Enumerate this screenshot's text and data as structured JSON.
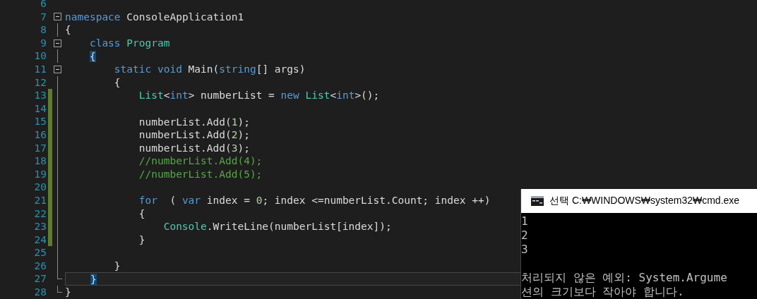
{
  "editor": {
    "lines": [
      {
        "number": "6"
      },
      {
        "number": "7",
        "collapsible": true,
        "tokens": [
          {
            "kind": "kw",
            "text": "namespace"
          },
          {
            "kind": "plain",
            "text": " ConsoleApplication1"
          }
        ]
      },
      {
        "number": "8",
        "in_block": true,
        "tokens": [
          {
            "kind": "plain",
            "text": "{"
          }
        ]
      },
      {
        "number": "9",
        "collapsible": true,
        "tokens": [
          {
            "kind": "kw",
            "text": "    class"
          },
          {
            "kind": "type",
            "text": " Program"
          }
        ]
      },
      {
        "number": "10",
        "in_block": true,
        "tokens": [
          {
            "kind": "brace",
            "text": "    {"
          }
        ]
      },
      {
        "number": "11",
        "collapsible": true,
        "tokens": [
          {
            "kind": "kw",
            "text": "        static void"
          },
          {
            "kind": "plain",
            "text": " Main("
          },
          {
            "kind": "kw",
            "text": "string"
          },
          {
            "kind": "plain",
            "text": "[] args)"
          }
        ]
      },
      {
        "number": "12",
        "in_block": true,
        "tokens": [
          {
            "kind": "plain",
            "text": "        {"
          }
        ]
      },
      {
        "number": "13",
        "in_block": true,
        "changed": true,
        "tokens": [
          {
            "kind": "type",
            "text": "            List"
          },
          {
            "kind": "plain",
            "text": "<"
          },
          {
            "kind": "kw",
            "text": "int"
          },
          {
            "kind": "plain",
            "text": "> numberList = "
          },
          {
            "kind": "kw",
            "text": "new"
          },
          {
            "kind": "type",
            "text": " List"
          },
          {
            "kind": "plain",
            "text": "<"
          },
          {
            "kind": "kw",
            "text": "int"
          },
          {
            "kind": "plain",
            "text": ">();"
          }
        ]
      },
      {
        "number": "14",
        "in_block": true,
        "changed": true
      },
      {
        "number": "15",
        "in_block": true,
        "changed": true,
        "tokens": [
          {
            "kind": "plain",
            "text": "            numberList.Add("
          },
          {
            "kind": "num",
            "text": "1"
          },
          {
            "kind": "plain",
            "text": ");"
          }
        ]
      },
      {
        "number": "16",
        "in_block": true,
        "changed": true,
        "tokens": [
          {
            "kind": "plain",
            "text": "            numberList.Add("
          },
          {
            "kind": "num",
            "text": "2"
          },
          {
            "kind": "plain",
            "text": ");"
          }
        ]
      },
      {
        "number": "17",
        "in_block": true,
        "changed": true,
        "tokens": [
          {
            "kind": "plain",
            "text": "            numberList.Add("
          },
          {
            "kind": "num",
            "text": "3"
          },
          {
            "kind": "plain",
            "text": ");"
          }
        ]
      },
      {
        "number": "18",
        "in_block": true,
        "changed": true,
        "tokens": [
          {
            "kind": "comment",
            "text": "            //numberList.Add(4);"
          }
        ]
      },
      {
        "number": "19",
        "in_block": true,
        "changed": true,
        "tokens": [
          {
            "kind": "comment",
            "text": "            //numberList.Add(5);"
          }
        ]
      },
      {
        "number": "20",
        "in_block": true,
        "changed": true
      },
      {
        "number": "21",
        "in_block": true,
        "changed": true,
        "tokens": [
          {
            "kind": "kw",
            "text": "            for"
          },
          {
            "kind": "plain",
            "text": "  ( "
          },
          {
            "kind": "kw",
            "text": "var"
          },
          {
            "kind": "plain",
            "text": " index = "
          },
          {
            "kind": "num",
            "text": "0"
          },
          {
            "kind": "plain",
            "text": "; index <=numberList.Count; index ++)"
          }
        ]
      },
      {
        "number": "22",
        "in_block": true,
        "changed": true,
        "tokens": [
          {
            "kind": "plain",
            "text": "            {"
          }
        ]
      },
      {
        "number": "23",
        "in_block": true,
        "changed": true,
        "tokens": [
          {
            "kind": "type",
            "text": "                Console"
          },
          {
            "kind": "plain",
            "text": ".WriteLine(numberList[index]);"
          }
        ]
      },
      {
        "number": "24",
        "in_block": true,
        "changed": true,
        "tokens": [
          {
            "kind": "plain",
            "text": "            }"
          }
        ]
      },
      {
        "number": "25",
        "in_block": true
      },
      {
        "number": "26",
        "in_block": true,
        "tokens": [
          {
            "kind": "plain",
            "text": "        }"
          }
        ]
      },
      {
        "number": "27",
        "block_end": true,
        "current": true,
        "tokens": [
          {
            "kind": "brace",
            "text": "    }"
          }
        ]
      },
      {
        "number": "28",
        "block_end": true,
        "tokens": [
          {
            "kind": "plain",
            "text": "}"
          }
        ]
      }
    ]
  },
  "console": {
    "title": "선택 C:₩WINDOWS₩system32₩cmd.exe",
    "lines": [
      {
        "text": "1"
      },
      {
        "text": "2"
      },
      {
        "text": "3"
      },
      {
        "text": "처리되지 않은 예외: System.Argume",
        "gap_before": true
      },
      {
        "text": "션의 크기보다 작아야 합니다."
      }
    ]
  }
}
